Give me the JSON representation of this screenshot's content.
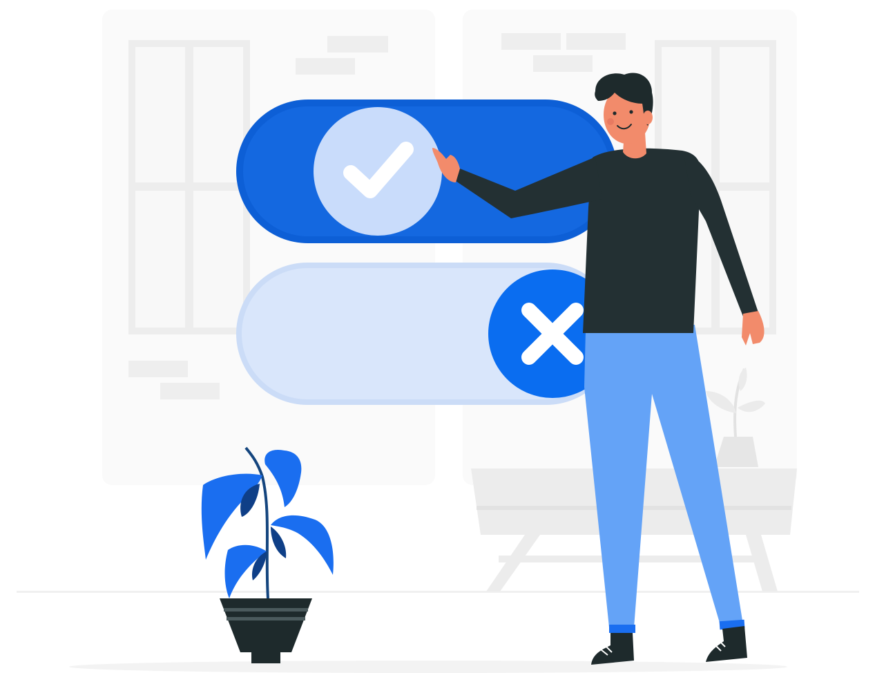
{
  "scene": {
    "description_text": "",
    "toggles": [
      {
        "state": "on",
        "icon": "check-icon"
      },
      {
        "state": "off",
        "icon": "close-icon"
      }
    ]
  },
  "colors": {
    "toggle_on_track": "#0d5fd6",
    "toggle_on_knob": "#c9dcfb",
    "toggle_off_track": "#d6e5fb",
    "toggle_off_knob": "#0a6df0",
    "person_shirt": "#233033",
    "person_pants": "#64a3f7",
    "person_skin": "#f28b6b",
    "person_hair": "#1e2a2c",
    "plant_leaf": "#1a6ef0",
    "plant_pot": "#1e2a2c",
    "background_shapes": "#f2f2f2"
  }
}
